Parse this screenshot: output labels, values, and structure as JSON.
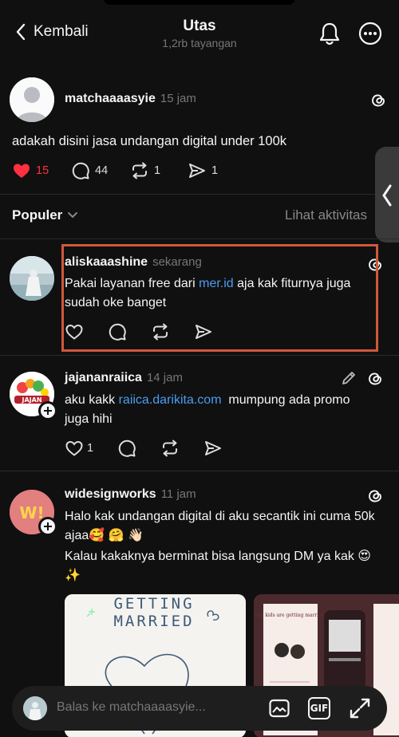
{
  "header": {
    "back_label": "Kembali",
    "title": "Utas",
    "subtitle": "1,2rb tayangan"
  },
  "post": {
    "username": "matchaaaasyie",
    "time": "15 jam",
    "text": "adakah disini jasa undangan digital under 100k",
    "likes": "15",
    "comments": "44",
    "reposts": "1",
    "shares": "1",
    "like_color": "#ff3040"
  },
  "sort": {
    "label": "Populer",
    "activity": "Lihat aktivitas"
  },
  "replies": [
    {
      "username": "aliskaaashine",
      "time": "sekarang",
      "text_before": "Pakai layanan free dari ",
      "link": "mer.id",
      "text_after": " aja kak fiturnya juga sudah oke banget"
    },
    {
      "username": "jajananraiica",
      "time": "14 jam",
      "text_before": "aku kakk ",
      "link": "raiica.darikita.com",
      "text_after": "  mumpung ada promo juga hihi",
      "likes": "1",
      "avatar_text": "JAJAN"
    },
    {
      "username": "widesignworks",
      "time": "11 jam",
      "line1": "Halo kak undangan digital di aku secantik ini cuma 50k ajaa🥰 🤗 👋🏻",
      "line2": "Kalau kakaknya berminat bisa langsung DM ya kak 😍 ✨",
      "avatar_text": "W!",
      "card1_title_a": "GETTING",
      "card1_title_b": "MARRIED",
      "card2_text": "this kids are getting married!"
    }
  ],
  "reply_bar": {
    "placeholder": "Balas ke matchaaaasyie...",
    "gif_label": "GIF"
  },
  "colors": {
    "background": "#101010",
    "link": "#4a9df0",
    "highlight": "#d0583c"
  }
}
